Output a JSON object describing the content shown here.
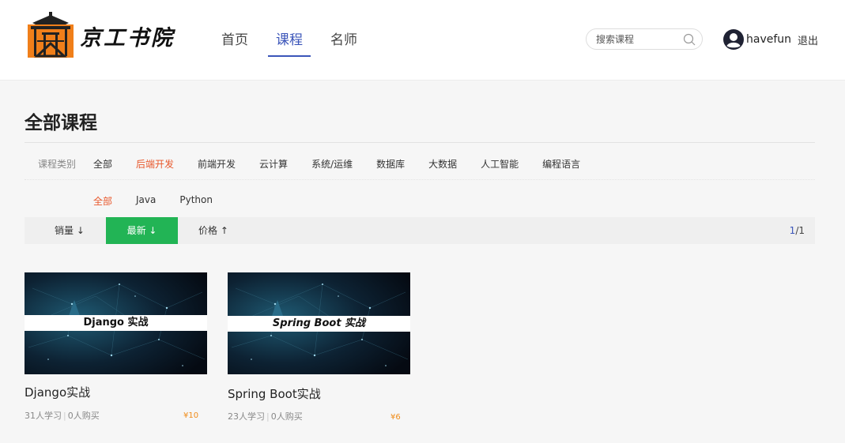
{
  "header": {
    "logo_text": "京工书院",
    "nav": [
      {
        "label": "首页",
        "active": false
      },
      {
        "label": "课程",
        "active": true
      },
      {
        "label": "名师",
        "active": false
      }
    ],
    "search": {
      "placeholder": "搜索课程",
      "value": ""
    },
    "user": {
      "name": "havefun",
      "logout_label": "退出"
    }
  },
  "main": {
    "title": "全部课程",
    "category_label": "课程类别",
    "categories": [
      {
        "label": "全部",
        "active": false
      },
      {
        "label": "后端开发",
        "active": true
      },
      {
        "label": "前端开发",
        "active": false
      },
      {
        "label": "云计算",
        "active": false
      },
      {
        "label": "系统/运维",
        "active": false
      },
      {
        "label": "数据库",
        "active": false
      },
      {
        "label": "大数据",
        "active": false
      },
      {
        "label": "人工智能",
        "active": false
      },
      {
        "label": "编程语言",
        "active": false
      }
    ],
    "subcategories": [
      {
        "label": "全部",
        "active": true
      },
      {
        "label": "Java",
        "active": false
      },
      {
        "label": "Python",
        "active": false
      }
    ],
    "sort": {
      "sales_label": "销量 ↓",
      "newest_label": "最新 ↓",
      "price_label": "价格 ↑",
      "active": "newest"
    },
    "pager": {
      "current": "1",
      "separator": "/",
      "total": "1"
    },
    "courses": [
      {
        "banner": "Django 实战",
        "title": "Django实战",
        "learners": "31人学习",
        "buyers": "0人购买",
        "price": "¥10"
      },
      {
        "banner": "Spring Boot 实战",
        "title": "Spring Boot实战",
        "learners": "23人学习",
        "buyers": "0人购买",
        "price": "¥6"
      }
    ]
  },
  "colors": {
    "accent_nav": "#3b55b9",
    "accent_category": "#e8582c",
    "sort_active": "#22b455",
    "price": "#f08c1a",
    "logo_orange": "#f07f1a"
  },
  "icons": [
    "logo-pavilion-icon",
    "search-icon",
    "user-avatar-icon"
  ]
}
